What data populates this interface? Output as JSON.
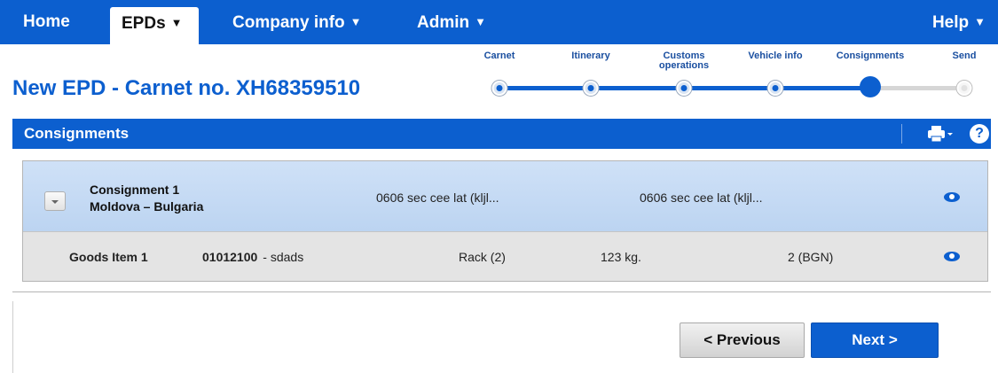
{
  "nav": {
    "home": "Home",
    "epds": "EPDs",
    "company": "Company info",
    "admin": "Admin",
    "help": "Help",
    "caret": "▼"
  },
  "page": {
    "title": "New EPD - Carnet no. XH68359510"
  },
  "stepper": {
    "steps": [
      "Carnet",
      "Itinerary",
      "Customs\noperations",
      "Vehicle info",
      "Consignments",
      "Send"
    ],
    "current_index": 4
  },
  "section": {
    "title": "Consignments",
    "help_glyph": "?"
  },
  "consignment": {
    "name": "Consignment 1",
    "route": "Moldova – Bulgaria",
    "col1": "0606 sec cee lat (kljl...",
    "col2": "0606 sec cee lat (kljl..."
  },
  "goods": {
    "name": "Goods Item 1",
    "code": "01012100",
    "description": "- sdads",
    "package": "Rack  (2)",
    "weight": "123  kg.",
    "value": "2  (BGN)"
  },
  "buttons": {
    "previous": "< Previous",
    "next": "Next >"
  },
  "colors": {
    "primary": "#0c5fcf",
    "row_blue": "#c6daf4",
    "row_grey": "#e4e4e4"
  }
}
